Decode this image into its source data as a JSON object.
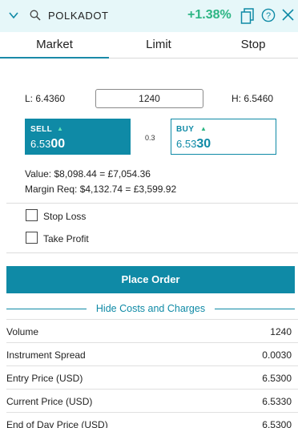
{
  "header": {
    "symbol": "POLKADOT",
    "change": "+1.38%",
    "icons": [
      "chevron-down-icon",
      "search-icon",
      "copy-icon",
      "help-icon",
      "close-icon"
    ],
    "accent_color": "#2db584",
    "background": "#e6f7f9"
  },
  "tabs": [
    {
      "label": "Market",
      "active": true
    },
    {
      "label": "Limit",
      "active": false
    },
    {
      "label": "Stop",
      "active": false
    }
  ],
  "order": {
    "low": "L: 6.4360",
    "quantity": "1240",
    "high": "H: 6.5460",
    "sell": {
      "label": "SELL",
      "price_main": "6.53",
      "price_big": "00"
    },
    "spread": "0.3",
    "buy": {
      "label": "BUY",
      "price_main": "6.53",
      "price_big": "30"
    },
    "value": "Value: $8,098.44 = £7,054.36",
    "margin": "Margin Req: $4,132.74 = £3,599.92"
  },
  "options": {
    "stop_loss": {
      "label": "Stop Loss",
      "checked": false
    },
    "take_profit": {
      "label": "Take Profit",
      "checked": false
    }
  },
  "place_order": "Place Order",
  "costs": {
    "toggle_label": "Hide Costs and Charges",
    "rows": [
      {
        "label": "Volume",
        "value": "1240"
      },
      {
        "label": "Instrument Spread",
        "value": "0.0030"
      },
      {
        "label": "Entry Price (USD)",
        "value": "6.5300"
      },
      {
        "label": "Current Price (USD)",
        "value": "6.5330"
      },
      {
        "label": "End of Day Price (USD)",
        "value": "6.5300"
      }
    ]
  },
  "colors": {
    "brand": "#0f8aa6",
    "positive": "#2db584"
  }
}
